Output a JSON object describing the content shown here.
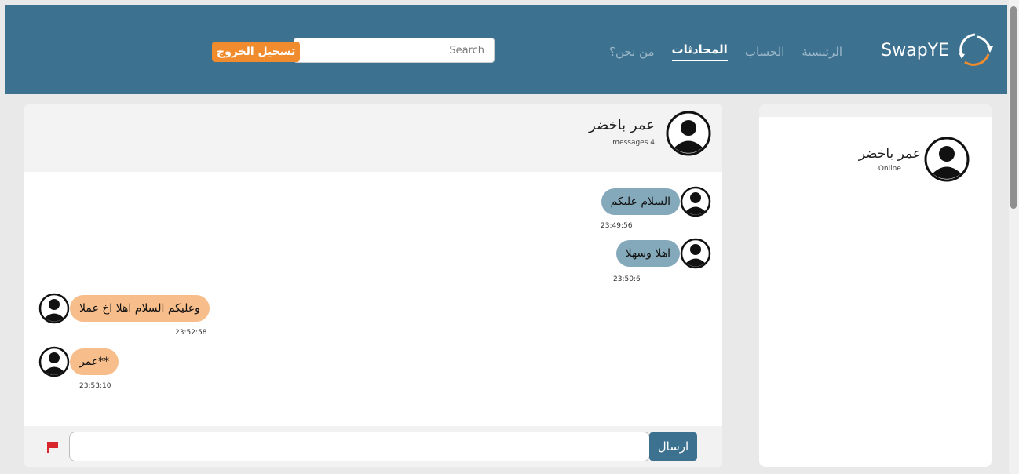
{
  "brand": {
    "name": "SwapYE",
    "logo_icon": "swap-arrows-icon"
  },
  "nav": {
    "links": [
      {
        "label": "الرئيسية",
        "active": false
      },
      {
        "label": "الحساب",
        "active": false
      },
      {
        "label": "المحادثات",
        "active": true
      },
      {
        "label": "من نحن؟",
        "active": false
      }
    ]
  },
  "search": {
    "placeholder": "Search",
    "value": ""
  },
  "logout": {
    "label": "تسجيل الخروج"
  },
  "chat": {
    "header": {
      "name": "عمر باخضر",
      "count_text": "messages 4"
    },
    "messages": [
      {
        "text": "السلام عليكم",
        "time": "23:49:56",
        "side": "right"
      },
      {
        "text": "اهلا وسهلا",
        "time": "23:50:6",
        "side": "right"
      },
      {
        "text": "وعليكم السلام اهلا اخ عملا",
        "time": "23:52:58",
        "side": "left"
      },
      {
        "text": "عمر**",
        "time": "23:53:10",
        "side": "left"
      }
    ],
    "composer": {
      "placeholder": "",
      "value": "",
      "send_label": "ارسال",
      "flag_icon": "flag-icon"
    }
  },
  "contacts": [
    {
      "name": "عمر باخضر",
      "status": "Online"
    }
  ],
  "colors": {
    "navbar": "#3d7190",
    "bubble_mine": "#84a9bb",
    "bubble_other": "#f7bd8b",
    "accent": "#f08b2e"
  }
}
